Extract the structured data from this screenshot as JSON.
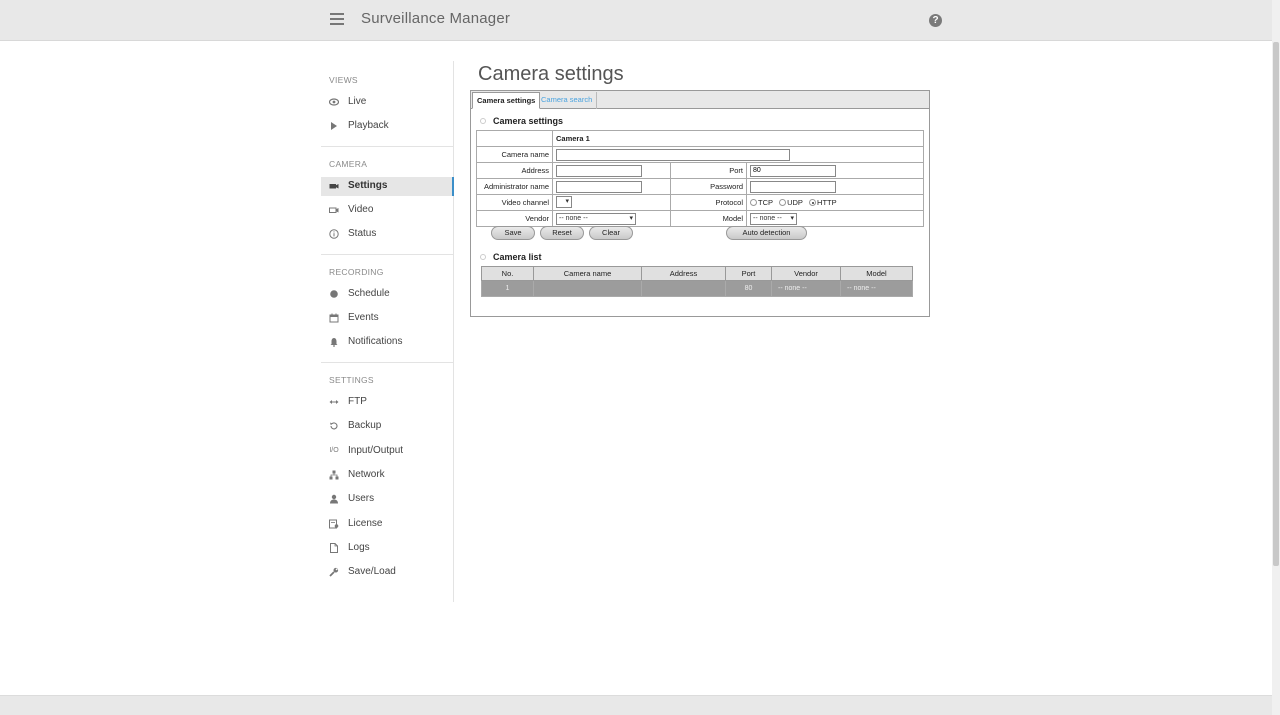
{
  "header": {
    "title": "Surveillance Manager",
    "help_glyph": "?"
  },
  "sidebar": {
    "sections": [
      {
        "label": "VIEWS",
        "items": [
          {
            "label": "Live",
            "icon": "eye-icon"
          },
          {
            "label": "Playback",
            "icon": "play-icon"
          }
        ]
      },
      {
        "label": "CAMERA",
        "items": [
          {
            "label": "Settings",
            "icon": "camera-icon",
            "active": true
          },
          {
            "label": "Video",
            "icon": "video-icon"
          },
          {
            "label": "Status",
            "icon": "info-icon"
          }
        ]
      },
      {
        "label": "RECORDING",
        "items": [
          {
            "label": "Schedule",
            "icon": "record-dot-icon"
          },
          {
            "label": "Events",
            "icon": "calendar-icon"
          },
          {
            "label": "Notifications",
            "icon": "bell-icon"
          }
        ]
      },
      {
        "label": "SETTINGS",
        "items": [
          {
            "label": "FTP",
            "icon": "transfer-icon"
          },
          {
            "label": "Backup",
            "icon": "history-icon"
          },
          {
            "label": "Input/Output",
            "icon": "io-icon",
            "glyph": "I/O"
          },
          {
            "label": "Network",
            "icon": "network-icon"
          },
          {
            "label": "Users",
            "icon": "user-icon"
          },
          {
            "label": "License",
            "icon": "license-icon"
          },
          {
            "label": "Logs",
            "icon": "document-icon"
          },
          {
            "label": "Save/Load",
            "icon": "wrench-icon"
          }
        ]
      }
    ]
  },
  "page": {
    "title": "Camera settings"
  },
  "tabs": [
    {
      "label": "Camera settings",
      "active": true
    },
    {
      "label": "Camera search",
      "active": false
    }
  ],
  "settings": {
    "heading": "Camera settings",
    "column_header": "Camera 1",
    "camera_name_label": "Camera name",
    "camera_name_value": "",
    "address_label": "Address",
    "address_value": "",
    "port_label": "Port",
    "port_value": "80",
    "admin_label": "Administrator name",
    "admin_value": "",
    "password_label": "Password",
    "password_value": "",
    "video_channel_label": "Video channel",
    "protocol_label": "Protocol",
    "protocol_options": [
      "TCP",
      "UDP",
      "HTTP"
    ],
    "protocol_selected": "HTTP",
    "vendor_label": "Vendor",
    "vendor_value": "-- none --",
    "model_label": "Model",
    "model_value": "-- none --"
  },
  "buttons": {
    "save": "Save",
    "reset": "Reset",
    "clear": "Clear",
    "auto_detection": "Auto detection"
  },
  "camera_list": {
    "heading": "Camera list",
    "columns": [
      "No.",
      "Camera name",
      "Address",
      "Port",
      "Vendor",
      "Model"
    ],
    "rows": [
      [
        "1",
        "",
        "",
        "80",
        "-- none --",
        "-- none --"
      ]
    ]
  }
}
